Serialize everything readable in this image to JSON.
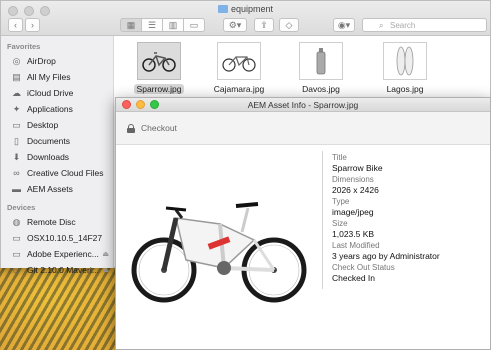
{
  "finder": {
    "title": "equipment",
    "search_placeholder": "Search",
    "sidebar": {
      "favorites_header": "Favorites",
      "favorites": [
        {
          "label": "AirDrop",
          "icon": "airdrop-icon"
        },
        {
          "label": "All My Files",
          "icon": "all-files-icon"
        },
        {
          "label": "iCloud Drive",
          "icon": "cloud-icon"
        },
        {
          "label": "Applications",
          "icon": "applications-icon"
        },
        {
          "label": "Desktop",
          "icon": "desktop-icon"
        },
        {
          "label": "Documents",
          "icon": "documents-icon"
        },
        {
          "label": "Downloads",
          "icon": "downloads-icon"
        },
        {
          "label": "Creative Cloud Files",
          "icon": "creative-cloud-icon"
        },
        {
          "label": "AEM Assets",
          "icon": "folder-icon"
        }
      ],
      "devices_header": "Devices",
      "devices": [
        {
          "label": "Remote Disc",
          "icon": "disc-icon"
        },
        {
          "label": "OSX10.10.5_14F27",
          "icon": "drive-icon"
        },
        {
          "label": "Adobe Experienc...",
          "icon": "drive-icon",
          "eject": true
        },
        {
          "label": "Git 2.10.0 Maveri...",
          "icon": "drive-icon",
          "eject": true
        }
      ]
    },
    "files": [
      {
        "name": "Sparrow.jpg",
        "selected": true
      },
      {
        "name": "Cajamara.jpg",
        "selected": false
      },
      {
        "name": "Davos.jpg",
        "selected": false
      },
      {
        "name": "Lagos.jpg",
        "selected": false
      }
    ]
  },
  "dialog": {
    "title": "AEM Asset Info - Sparrow.jpg",
    "checkout_label": "Checkout",
    "properties": [
      {
        "label": "Title",
        "value": "Sparrow Bike"
      },
      {
        "label": "Dimensions",
        "value": "2026 x 2426"
      },
      {
        "label": "Type",
        "value": "image/jpeg"
      },
      {
        "label": "Size",
        "value": "1,023.5 KB"
      },
      {
        "label": "Last Modified",
        "value": "3 years ago by Administrator"
      },
      {
        "label": "Check Out Status",
        "value": "Checked In"
      }
    ]
  },
  "colors": {
    "close": "#fc605c",
    "minimize": "#fdbc40",
    "zoom": "#34c84a",
    "folder": "#7fb3e8"
  }
}
